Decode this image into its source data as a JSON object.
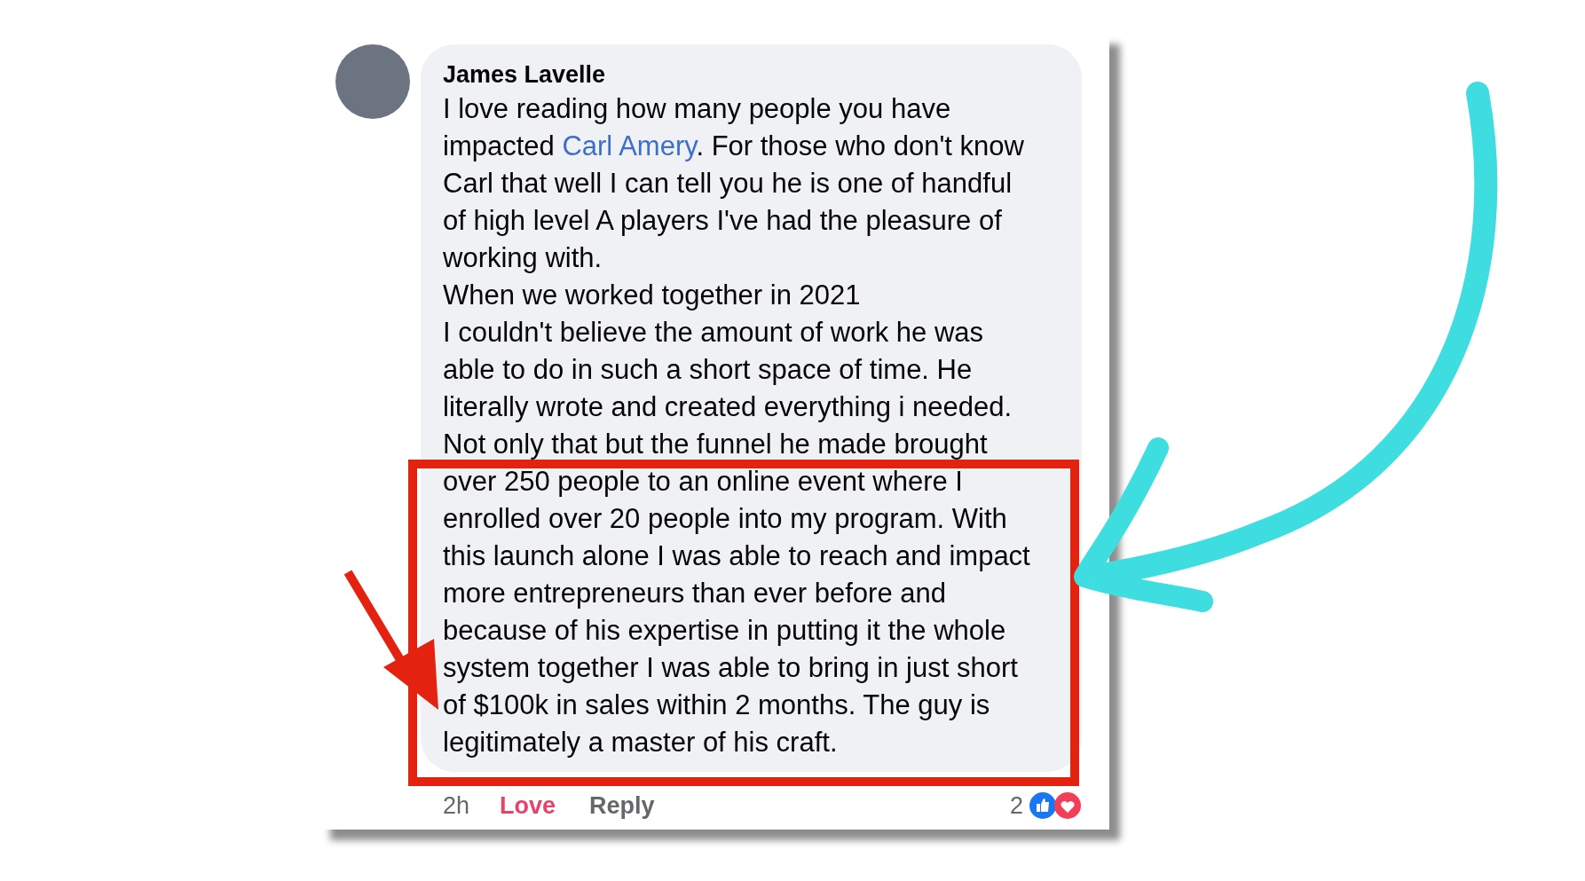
{
  "comment": {
    "author": "James Lavelle",
    "lines": [
      {
        "text": "I love reading how many people you have"
      },
      {
        "before": "impacted ",
        "mention": "Carl Amery",
        "after": ". For those who don't know"
      },
      {
        "text": "Carl that well I can tell you he is one of handful"
      },
      {
        "text": "of high level A players I've had the pleasure of"
      },
      {
        "text": "working with."
      },
      {
        "text": "When we worked together in 2021"
      },
      {
        "text": "I couldn't believe the amount of work he was"
      },
      {
        "text": "able to do in such a short space of time. He"
      },
      {
        "text": "literally wrote and created everything i needed."
      },
      {
        "text": "Not only that but the funnel he made brought"
      },
      {
        "text": "over 250 people to an online event where I"
      },
      {
        "text": "enrolled over 20 people into my program. With"
      },
      {
        "text": "this launch alone I was able to reach and impact"
      },
      {
        "text": "more entrepreneurs than ever before and"
      },
      {
        "text": "because of his expertise in putting it the whole"
      },
      {
        "text": "system together I was able to bring in just short"
      },
      {
        "text": "of $100k in sales within 2 months. The guy is"
      },
      {
        "text": "legitimately a master of his craft."
      }
    ],
    "time": "2h",
    "reaction_button": {
      "label": "Love",
      "selected": true
    },
    "reply": "Reply",
    "reaction_count": "2"
  }
}
